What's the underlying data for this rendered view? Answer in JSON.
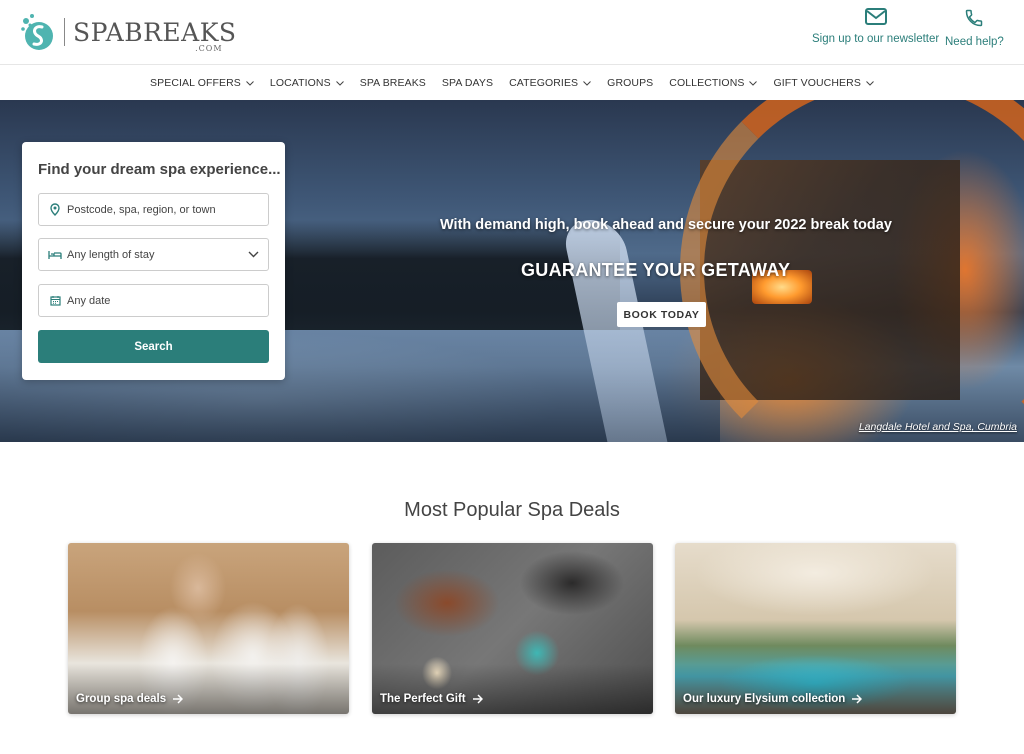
{
  "brand": {
    "name": "SPABREAKS",
    "suffix": ".COM"
  },
  "header": {
    "newsletter_label": "Sign up to our newsletter",
    "help_label": "Need help?"
  },
  "nav": {
    "items": [
      {
        "label": "SPECIAL OFFERS",
        "dropdown": true
      },
      {
        "label": "LOCATIONS",
        "dropdown": true
      },
      {
        "label": "SPA BREAKS",
        "dropdown": false
      },
      {
        "label": "SPA DAYS",
        "dropdown": false
      },
      {
        "label": "CATEGORIES",
        "dropdown": true
      },
      {
        "label": "GROUPS",
        "dropdown": false
      },
      {
        "label": "COLLECTIONS",
        "dropdown": true
      },
      {
        "label": "GIFT VOUCHERS",
        "dropdown": true
      }
    ]
  },
  "hero": {
    "tagline": "With demand high, book ahead and secure your 2022 break today",
    "title": "GUARANTEE YOUR GETAWAY",
    "button": "BOOK TODAY",
    "caption": "Langdale Hotel and Spa, Cumbria"
  },
  "search": {
    "title": "Find your dream spa experience...",
    "location_placeholder": "Postcode, spa, region, or town",
    "stay_value": "Any length of stay",
    "date_value": "Any date",
    "button": "Search"
  },
  "popular": {
    "title": "Most Popular Spa Deals",
    "cards": [
      {
        "label": "Group spa deals"
      },
      {
        "label": "The Perfect Gift"
      },
      {
        "label": "Our luxury Elysium collection"
      }
    ]
  },
  "colors": {
    "accent": "#2b7e7a"
  }
}
